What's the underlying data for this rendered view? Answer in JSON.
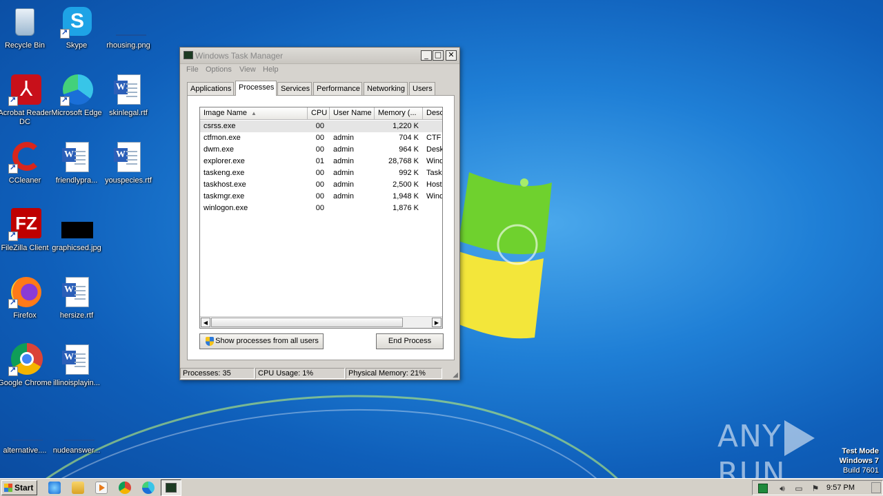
{
  "desktop": {
    "icons": [
      {
        "label": "Recycle Bin"
      },
      {
        "label": "Skype"
      },
      {
        "label": "rhousing.png"
      },
      {
        "label": "Acrobat Reader DC"
      },
      {
        "label": "Microsoft Edge"
      },
      {
        "label": "skinlegal.rtf"
      },
      {
        "label": "CCleaner"
      },
      {
        "label": "friendlypra..."
      },
      {
        "label": "youspecies.rtf"
      },
      {
        "label": "FileZilla Client"
      },
      {
        "label": "graphicsed.jpg"
      },
      {
        "label": "Firefox"
      },
      {
        "label": "hersize.rtf"
      },
      {
        "label": "Google Chrome"
      },
      {
        "label": "illinoisplayin..."
      },
      {
        "label": "alternative...."
      },
      {
        "label": "nudeanswer..."
      }
    ]
  },
  "window": {
    "title": "Windows Task Manager",
    "menu": [
      "File",
      "Options",
      "View",
      "Help"
    ],
    "tabs": [
      "Applications",
      "Processes",
      "Services",
      "Performance",
      "Networking",
      "Users"
    ],
    "active_tab": "Processes",
    "columns": [
      "Image Name",
      "CPU",
      "User Name",
      "Memory (...",
      "Desc"
    ],
    "processes": [
      {
        "name": "csrss.exe",
        "cpu": "00",
        "user": "",
        "memory": "1,220 K",
        "desc": ""
      },
      {
        "name": "ctfmon.exe",
        "cpu": "00",
        "user": "admin",
        "memory": "704 K",
        "desc": "CTF L"
      },
      {
        "name": "dwm.exe",
        "cpu": "00",
        "user": "admin",
        "memory": "964 K",
        "desc": "Deskt"
      },
      {
        "name": "explorer.exe",
        "cpu": "01",
        "user": "admin",
        "memory": "28,768 K",
        "desc": "Wind"
      },
      {
        "name": "taskeng.exe",
        "cpu": "00",
        "user": "admin",
        "memory": "992 K",
        "desc": "Task"
      },
      {
        "name": "taskhost.exe",
        "cpu": "00",
        "user": "admin",
        "memory": "2,500 K",
        "desc": "Host"
      },
      {
        "name": "taskmgr.exe",
        "cpu": "00",
        "user": "admin",
        "memory": "1,948 K",
        "desc": "Wind"
      },
      {
        "name": "winlogon.exe",
        "cpu": "00",
        "user": "",
        "memory": "1,876 K",
        "desc": ""
      }
    ],
    "show_all_button": "Show processes from all users",
    "end_process_button": "End Process",
    "status": {
      "processes": "Processes: 35",
      "cpu": "CPU Usage: 1%",
      "memory": "Physical Memory: 21%"
    }
  },
  "watermark": {
    "left": "ANY",
    "right": "RUN"
  },
  "test_mode": {
    "line1": "Test Mode",
    "line2": "Windows 7",
    "line3": "Build 7601"
  },
  "taskbar": {
    "start_label": "Start",
    "clock": "9:57 PM"
  }
}
